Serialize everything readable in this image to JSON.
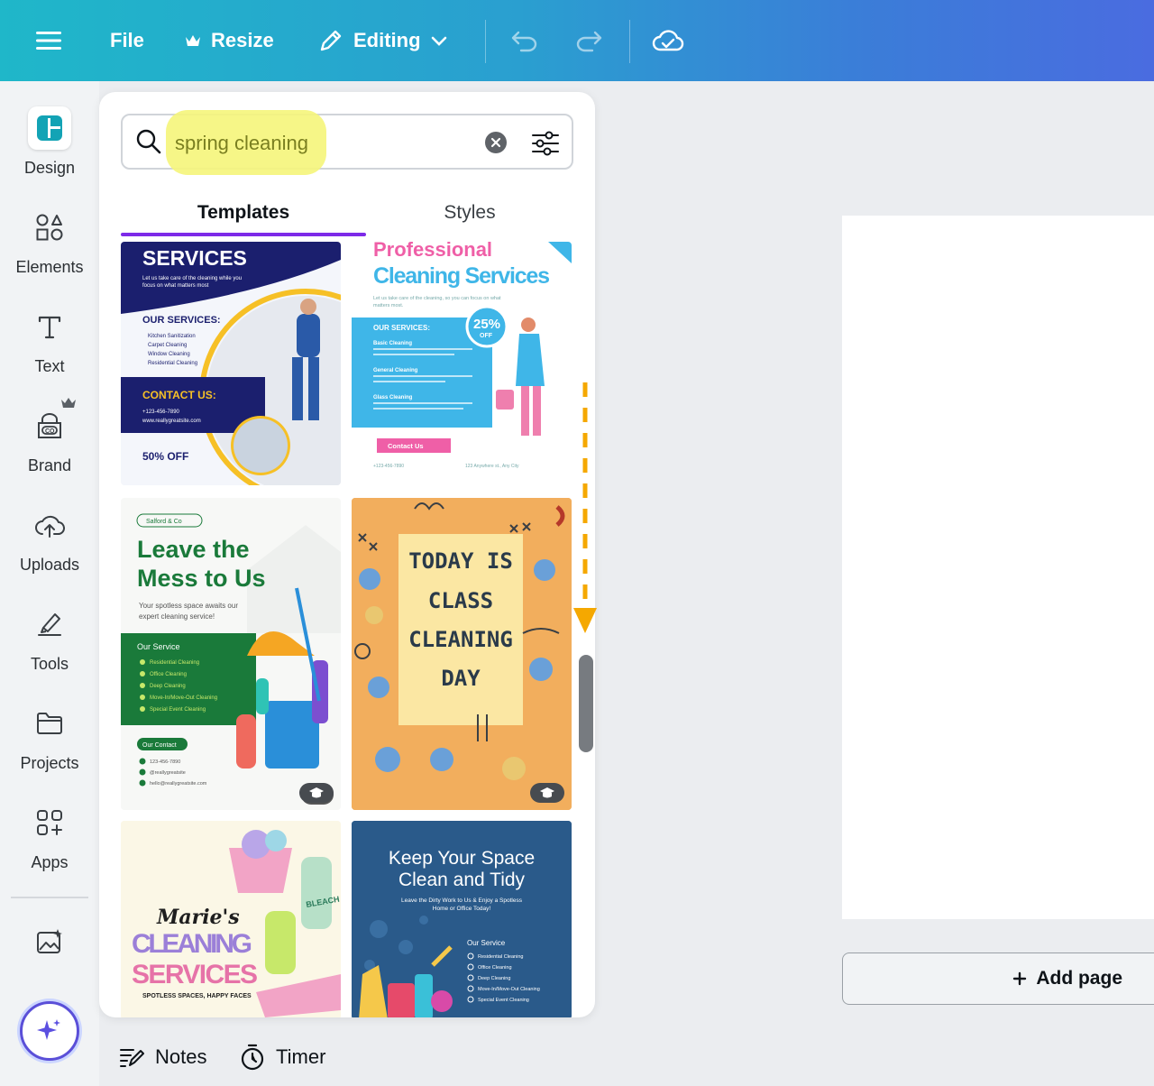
{
  "topbar": {
    "file_label": "File",
    "resize_label": "Resize",
    "editing_label": "Editing"
  },
  "rail": {
    "items": [
      {
        "label": "Design"
      },
      {
        "label": "Elements"
      },
      {
        "label": "Text"
      },
      {
        "label": "Brand"
      },
      {
        "label": "Uploads"
      },
      {
        "label": "Tools"
      },
      {
        "label": "Projects"
      },
      {
        "label": "Apps"
      }
    ]
  },
  "search": {
    "value": "spring cleaning"
  },
  "tabs": [
    {
      "label": "Templates"
    },
    {
      "label": "Styles"
    }
  ],
  "templates": {
    "t1": {
      "title": "SERVICES",
      "subtitle": "Let us take care of the cleaning while you focus on what matters most",
      "services_label": "OUR SERVICES:",
      "services": [
        "Kitchen Sanitization",
        "Carpet Cleaning",
        "Window Cleaning",
        "Residential Cleaning"
      ],
      "contact_label": "CONTACT US:",
      "phone": "+123-456-7890",
      "site": "www.reallygreatsite.com",
      "offer": "50% OFF"
    },
    "t2": {
      "title_top": "Professional",
      "title_bottom": "Cleaning Services",
      "subtitle": "Let us take care of the cleaning, so you can focus on what matters most.",
      "services_label": "OUR SERVICES:",
      "discount": "25%",
      "discount_sub": "OFF",
      "items": [
        "Basic Cleaning",
        "General Cleaning",
        "Glass Cleaning"
      ],
      "contact_btn": "Contact Us",
      "phone": "+123-456-7890",
      "address": "123 Anywhere st., Any City"
    },
    "t3": {
      "brand": "Salford & Co",
      "title_1": "Leave the",
      "title_2": "Mess to Us",
      "subtitle": "Your spotless space awaits our expert cleaning service!",
      "service_label": "Our Service",
      "services": [
        "Residential Cleaning",
        "Office Cleaning",
        "Deep Cleaning",
        "Move-In/Move-Out Cleaning",
        "Special Event Cleaning"
      ],
      "contact_label": "Our Contact",
      "contacts": [
        "123-456-7890",
        "@reallygreatsite",
        "hello@reallygreatsite.com"
      ]
    },
    "t4": {
      "lines": [
        "TODAY IS",
        "CLASS",
        "CLEANING",
        "DAY"
      ]
    },
    "t5": {
      "title_1": "Marie's",
      "title_2": "CLEANING",
      "title_3": "SERVICES",
      "tagline": "SPOTLESS SPACES, HAPPY FACES",
      "bottle_label": "BLEACH"
    },
    "t6": {
      "title_1": "Keep Your Space",
      "title_2": "Clean and Tidy",
      "subtitle_1": "Leave the Dirty Work to Us & Enjoy a Spotless",
      "subtitle_2": "Home or Office Today!",
      "service_label": "Our Service",
      "services": [
        "Residential Cleaning",
        "Office Cleaning",
        "Deep Cleaning",
        "Move-In/Move-Out Cleaning",
        "Special Event Cleaning"
      ]
    }
  },
  "canvas": {
    "add_page_label": "Add page"
  },
  "footer": {
    "notes_label": "Notes",
    "timer_label": "Timer"
  },
  "colors": {
    "accent": "#7d2ae8",
    "topbar_start": "#1fb7c9",
    "topbar_end": "#4a6ce0",
    "highlight": "#f5f57a",
    "annotation_arrow": "#f5a800"
  }
}
